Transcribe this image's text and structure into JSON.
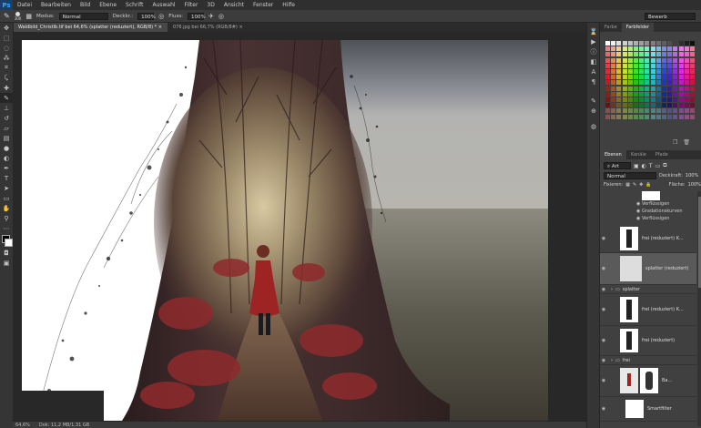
{
  "app": {
    "logo": "Ps"
  },
  "menu": [
    "Datei",
    "Bearbeiten",
    "Bild",
    "Ebene",
    "Schrift",
    "Auswahl",
    "Filter",
    "3D",
    "Ansicht",
    "Fenster",
    "Hilfe"
  ],
  "options": {
    "brush_size": "300",
    "mode_label": "Modus:",
    "mode_value": "Normal",
    "opacity_label": "Deckkr.:",
    "opacity_value": "100%",
    "flow_label": "Fluss:",
    "flow_value": "100%",
    "workspace": "Bewerb"
  },
  "tabs": [
    {
      "label": "Waldbild_Christlb.tif bei 64,6% (splatter (reduziert), RGB/8) *",
      "active": true
    },
    {
      "label": "076.jpg bei 66,7% (RGB/8#)",
      "active": false
    }
  ],
  "status": {
    "zoom": "64,6%",
    "doc": "Dok: 11,2 MB/1,31 GB"
  },
  "panels": {
    "swatch_tabs": [
      "Farbe",
      "Farbfelder"
    ],
    "layer_tabs": [
      "Ebenen",
      "Kanäle",
      "Pfade"
    ],
    "filter_kind": "Art",
    "blend_mode": "Normal",
    "opacity_label": "Deckkraft:",
    "opacity_value": "100%",
    "lock_label": "Fixieren:",
    "fill_label": "Fläche:",
    "fill_value": "100%"
  },
  "layers": {
    "fx": [
      "Verflüssigen",
      "Gradationskurven",
      "Verflüssigen"
    ],
    "items": [
      {
        "name": "frei (reduziert) K..."
      },
      {
        "name": "splatter (reduziert)"
      },
      {
        "name": "splatter"
      },
      {
        "name": "frei (reduziert) K..."
      },
      {
        "name": "frei (reduziert)"
      },
      {
        "name": "frei"
      },
      {
        "name": "Ba..."
      },
      {
        "name": "Smartfilter"
      }
    ]
  },
  "colors": {
    "ui_dark": "#2f2f2f",
    "ui_panel": "#404040",
    "accent": "#31a8ff"
  }
}
